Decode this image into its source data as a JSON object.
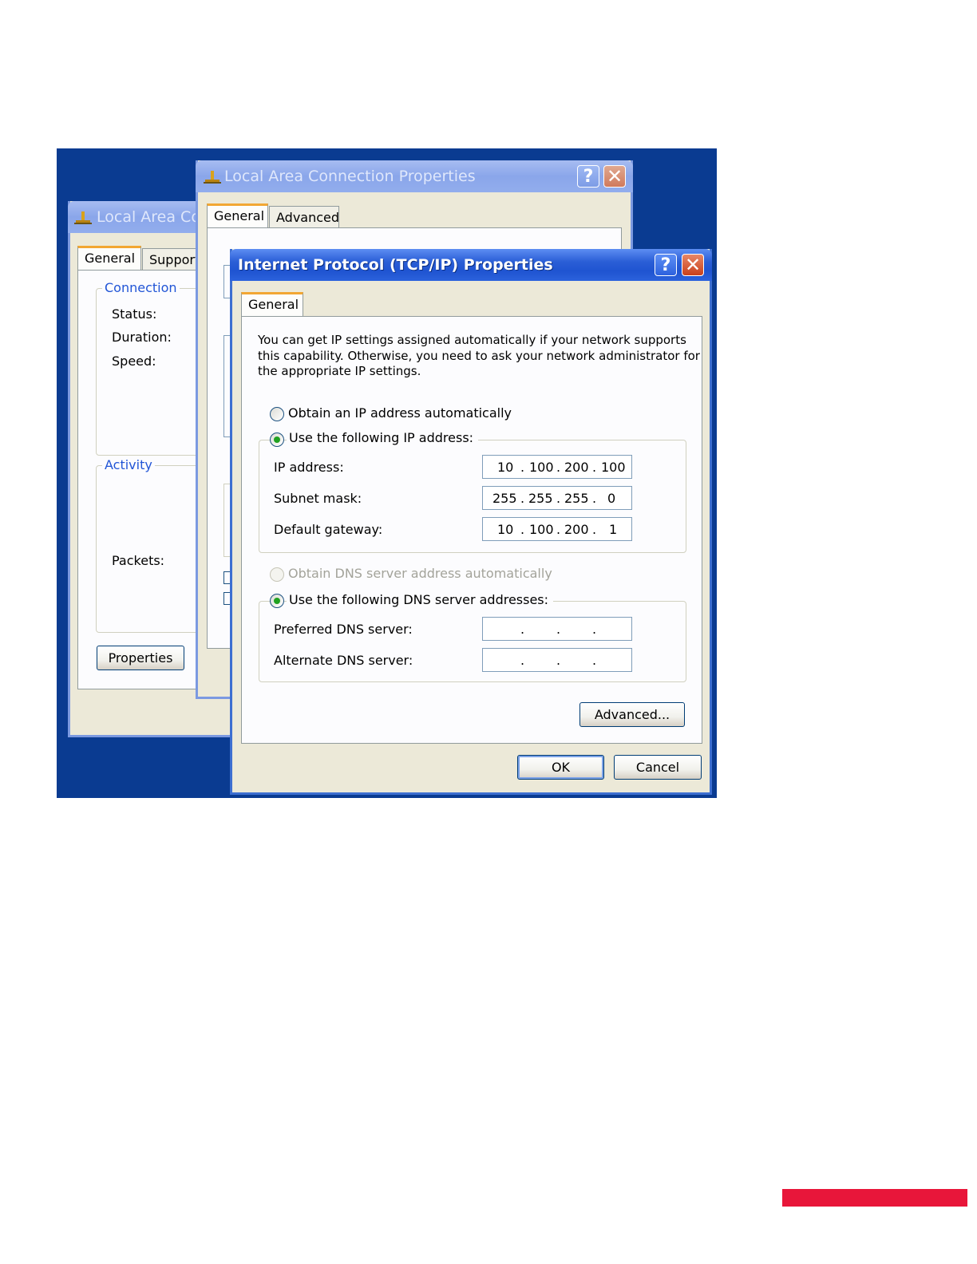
{
  "back_window": {
    "title": "Local Area Co",
    "tabs": [
      "General",
      "Support"
    ],
    "connection_group": "Connection",
    "status_label": "Status:",
    "duration_label": "Duration:",
    "speed_label": "Speed:",
    "activity_group": "Activity",
    "packets_label": "Packets:",
    "properties_button": "Properties"
  },
  "middle_window": {
    "title": "Local Area Connection Properties",
    "tabs": [
      "General",
      "Advanced"
    ],
    "help_glyph": "?",
    "close_glyph": "✕"
  },
  "front_window": {
    "title": "Internet Protocol (TCP/IP) Properties",
    "help_glyph": "?",
    "close_glyph": "✕",
    "tab": "General",
    "description": [
      "You can get IP settings assigned automatically if your network supports",
      "this capability. Otherwise, you need to ask your network administrator for",
      "the appropriate IP settings."
    ],
    "radio_auto_ip": "Obtain an IP address automatically",
    "radio_manual_ip": "Use the following IP address:",
    "ip_address_label": "IP address:",
    "ip_address": [
      "10",
      "100",
      "200",
      "100"
    ],
    "subnet_mask_label": "Subnet mask:",
    "subnet_mask": [
      "255",
      "255",
      "255",
      "0"
    ],
    "default_gateway_label": "Default gateway:",
    "default_gateway": [
      "10",
      "100",
      "200",
      "1"
    ],
    "radio_auto_dns": "Obtain DNS server address automatically",
    "radio_manual_dns": "Use the following DNS server addresses:",
    "preferred_dns_label": "Preferred DNS server:",
    "alternate_dns_label": "Alternate DNS server:",
    "dot": ".",
    "advanced_button": "Advanced...",
    "ok_button": "OK",
    "cancel_button": "Cancel"
  },
  "colors": {
    "desktop": "#0a3b91",
    "accent_bar": "#e8163a",
    "titlebar_active": "#2a5ed6",
    "dialog_face": "#ece9d8"
  }
}
